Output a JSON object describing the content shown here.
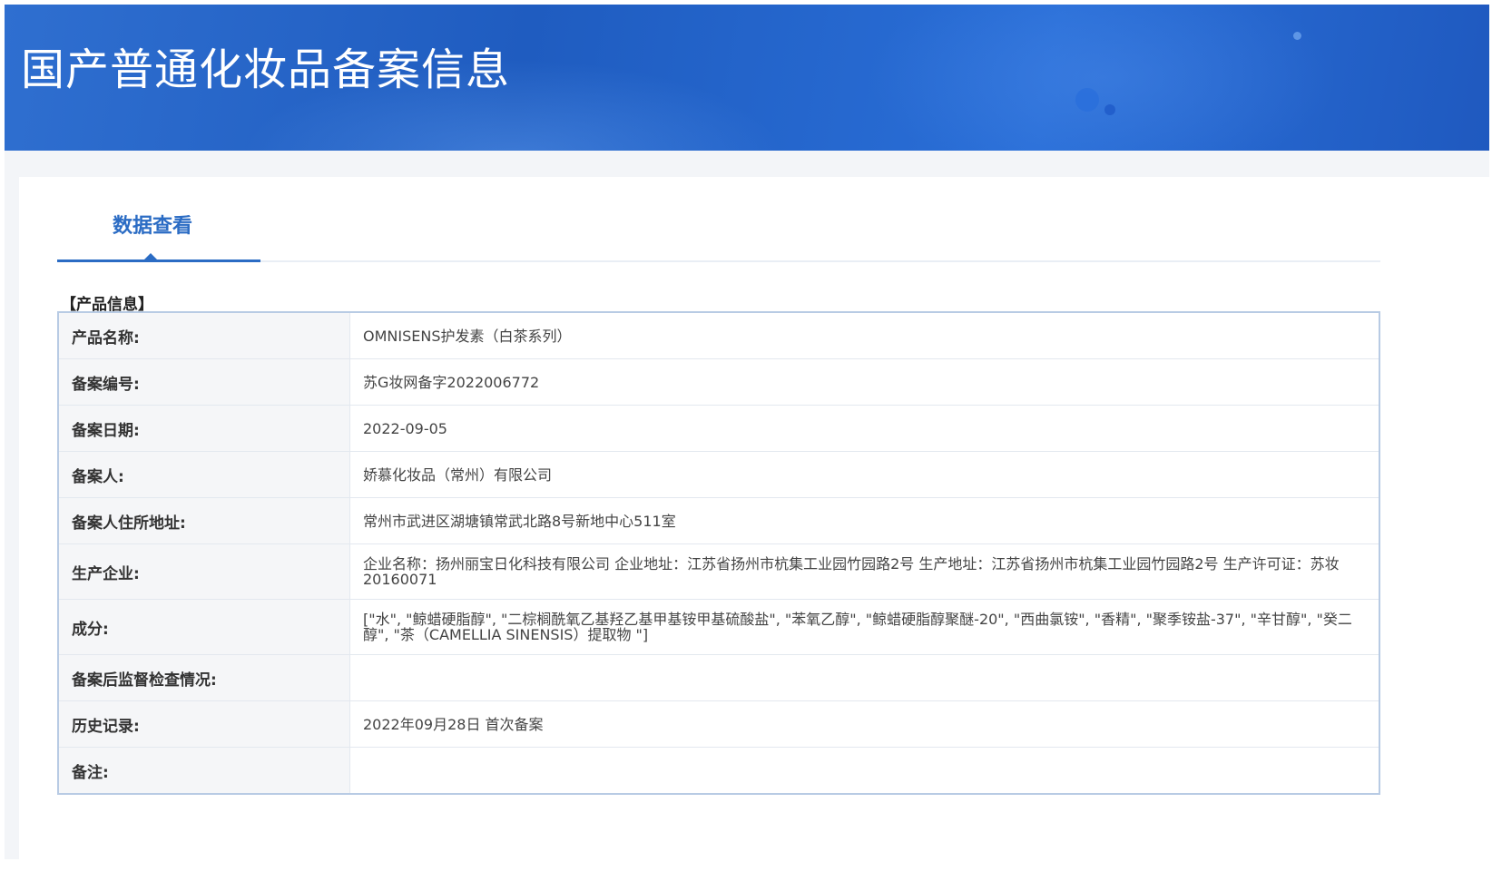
{
  "header": {
    "title": "国产普通化妆品备案信息"
  },
  "tabs": [
    {
      "label": "数据查看",
      "active": true
    }
  ],
  "section": {
    "title": "【产品信息】"
  },
  "fields": [
    {
      "label": "产品名称:",
      "value": "OMNISENS护发素（白茶系列）"
    },
    {
      "label": "备案编号:",
      "value": "苏G妆网备字2022006772"
    },
    {
      "label": "备案日期:",
      "value": "2022-09-05"
    },
    {
      "label": "备案人:",
      "value": "娇慕化妆品（常州）有限公司"
    },
    {
      "label": "备案人住所地址:",
      "value": "常州市武进区湖塘镇常武北路8号新地中心511室"
    },
    {
      "label": "生产企业:",
      "value": "企业名称：扬州丽宝日化科技有限公司 企业地址：江苏省扬州市杭集工业园竹园路2号 生产地址：江苏省扬州市杭集工业园竹园路2号 生产许可证：苏妆20160071"
    },
    {
      "label": "成分:",
      "value": "[\"水\", \"鲸蜡硬脂醇\", \"二棕榈酰氧乙基羟乙基甲基铵甲基硫酸盐\", \"苯氧乙醇\", \"鲸蜡硬脂醇聚醚-20\", \"西曲氯铵\", \"香精\", \"聚季铵盐-37\", \"辛甘醇\", \"癸二醇\", \"茶（CAMELLIA SINENSIS）提取物 \"]"
    },
    {
      "label": "备案后监督检查情况:",
      "value": ""
    },
    {
      "label": "历史记录:",
      "value": "2022年09月28日 首次备案"
    },
    {
      "label": "备注:",
      "value": ""
    }
  ],
  "colors": {
    "banner": "#2566c8",
    "accent": "#2b6cc4",
    "table_border": "#b8cbe4",
    "label_bg": "#f5f6f8"
  }
}
